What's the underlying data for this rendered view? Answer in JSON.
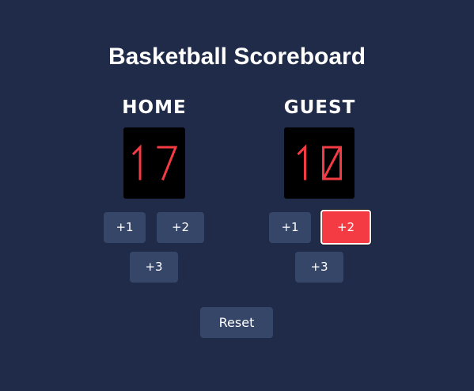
{
  "title": "Basketball Scoreboard",
  "home": {
    "label": "HOME",
    "score": 17,
    "buttons": [
      "+1",
      "+2",
      "+3"
    ]
  },
  "guest": {
    "label": "GUEST",
    "score": 10,
    "buttons": [
      "+1",
      "+2",
      "+3"
    ],
    "active_button": "+2"
  },
  "reset_label": "Reset",
  "colors": {
    "background": "#1f2b48",
    "button": "#364668",
    "score_digit": "#f43b44",
    "score_box": "#000000",
    "active_button": "#f43b44",
    "text": "#ffffff"
  }
}
